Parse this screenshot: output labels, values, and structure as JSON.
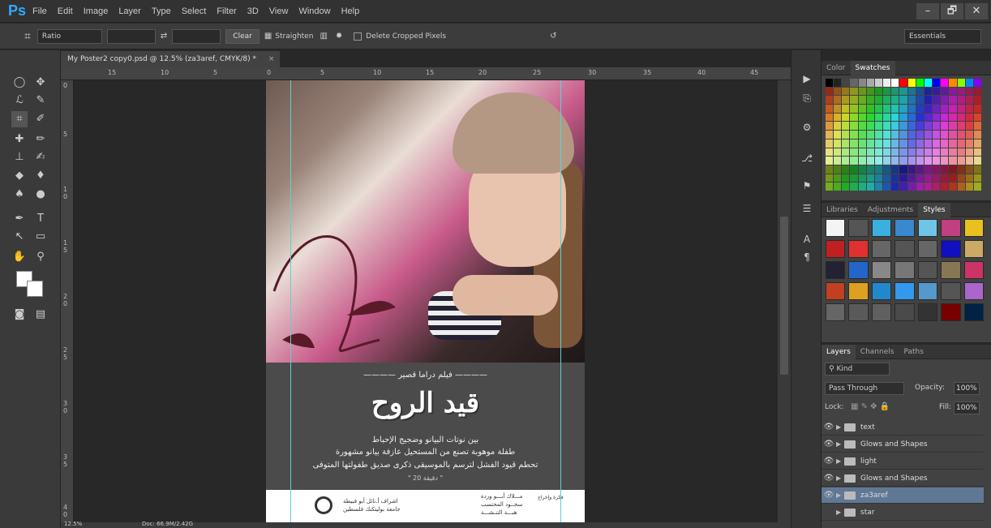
{
  "app": {
    "logo": "Ps"
  },
  "menu": [
    "File",
    "Edit",
    "Image",
    "Layer",
    "Type",
    "Select",
    "Filter",
    "3D",
    "View",
    "Window",
    "Help"
  ],
  "window_controls": {
    "minimize": "–",
    "restore": "🗗",
    "close": "✕"
  },
  "options": {
    "ratio": "Ratio",
    "clear": "Clear",
    "straighten": "Straighten",
    "delete_cropped": "Delete Cropped Pixels",
    "workspace": "Essentials"
  },
  "document": {
    "tab_title": "My Poster2 copy0.psd @ 12.5% (za3aref, CMYK/8) *",
    "close": "×"
  },
  "ruler_top": [
    "15",
    "10",
    "5",
    "0",
    "5",
    "10",
    "15",
    "20",
    "25",
    "30",
    "35",
    "40",
    "45"
  ],
  "ruler_left": [
    "0",
    "5",
    "1\n0",
    "1\n5",
    "2\n0",
    "2\n5",
    "3\n0",
    "3\n5",
    "4\n0"
  ],
  "status": {
    "zoom": "12.5%",
    "doc": "Doc: 66.9M/2.42G"
  },
  "poster": {
    "subtitle": "———— فيلم دراما قصير ————",
    "title": "قيد الروح",
    "line1": "بين نوتات البيانو وضجيج الإحباط",
    "line2": "طفلة موهوبة تصنع من المستحيل عازفة بيانو مشهورة",
    "line3": "تحطم قيود الفشل لترسم بالموسيقى ذكرى صديق طفولتها المتوفى",
    "duration": "\" 20 دقيقة \"",
    "footer_left1": "اشراف أ.نائل أبو فبيطة",
    "footer_left2": "جامعة بوليتكنك فلسطين",
    "footer_right1": "مـــلاك أبـــو وردة",
    "footer_right2": "سجــود المحتسب",
    "footer_right3": "هبـــة التنـشـــة",
    "footer_right_label": "فكرة وإخراج"
  },
  "panels": {
    "color_tabs": [
      "Color",
      "Swatches"
    ],
    "mid_tabs": [
      "Libraries",
      "Adjustments",
      "Styles"
    ],
    "layer_tabs": [
      "Layers",
      "Channels",
      "Paths"
    ],
    "kind": "Kind",
    "blend": "Pass Through",
    "opacity_label": "Opacity:",
    "opacity": "100%",
    "lock_label": "Lock:",
    "fill_label": "Fill:",
    "fill": "100%"
  },
  "layers": [
    {
      "name": "text",
      "visible": true,
      "selected": false
    },
    {
      "name": "Glows and Shapes",
      "visible": true,
      "selected": false
    },
    {
      "name": "light",
      "visible": true,
      "selected": false
    },
    {
      "name": "Glows and Shapes",
      "visible": true,
      "selected": false
    },
    {
      "name": "za3aref",
      "visible": true,
      "selected": true
    },
    {
      "name": "star",
      "visible": false,
      "selected": false
    }
  ]
}
